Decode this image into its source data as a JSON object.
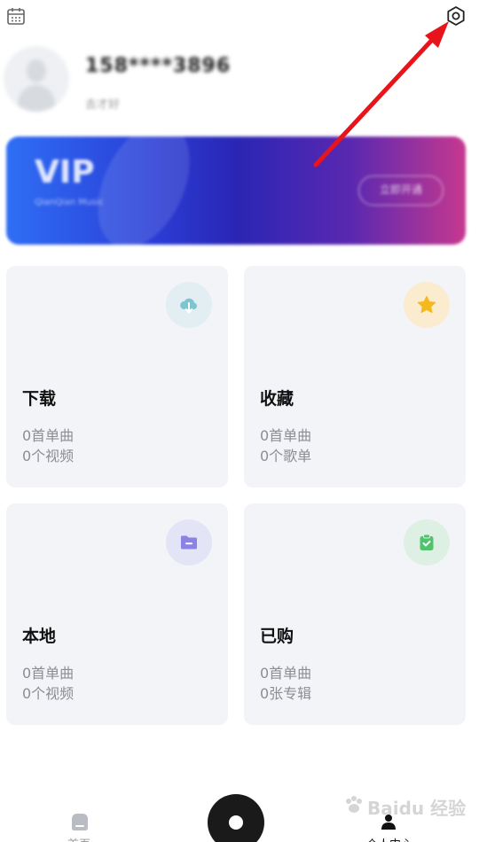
{
  "header": {
    "calendar_icon": "calendar-icon",
    "settings_icon": "settings-icon"
  },
  "profile": {
    "phone": "158****3896",
    "nickname": "去才好"
  },
  "vip": {
    "title": "VIP",
    "subtitle": "QianQian Music",
    "button": "立即开通",
    "colors": [
      "#2f6ef5",
      "#2a26b5",
      "#c6388f"
    ]
  },
  "cards": [
    {
      "title": "下载",
      "line1": "0首单曲",
      "line2": "0个视频",
      "icon": "cloud-download-icon",
      "icon_bg": "#e3eef3",
      "icon_color": "#7ec4d2"
    },
    {
      "title": "收藏",
      "line1": "0首单曲",
      "line2": "0个歌单",
      "icon": "star-icon",
      "icon_bg": "#fbecd0",
      "icon_color": "#f5b91d"
    },
    {
      "title": "本地",
      "line1": "0首单曲",
      "line2": "0个视频",
      "icon": "folder-icon",
      "icon_bg": "#e4e4f7",
      "icon_color": "#8b82e6"
    },
    {
      "title": "已购",
      "line1": "0首单曲",
      "line2": "0张专辑",
      "icon": "bag-check-icon",
      "icon_bg": "#def0e3",
      "icon_color": "#4fc46c"
    }
  ],
  "bottom_nav": {
    "home_label": "首页",
    "me_label": "个人中心"
  },
  "watermark": {
    "text": "Baidu 经验"
  },
  "annotation": {
    "arrow_color": "#e8141b"
  }
}
